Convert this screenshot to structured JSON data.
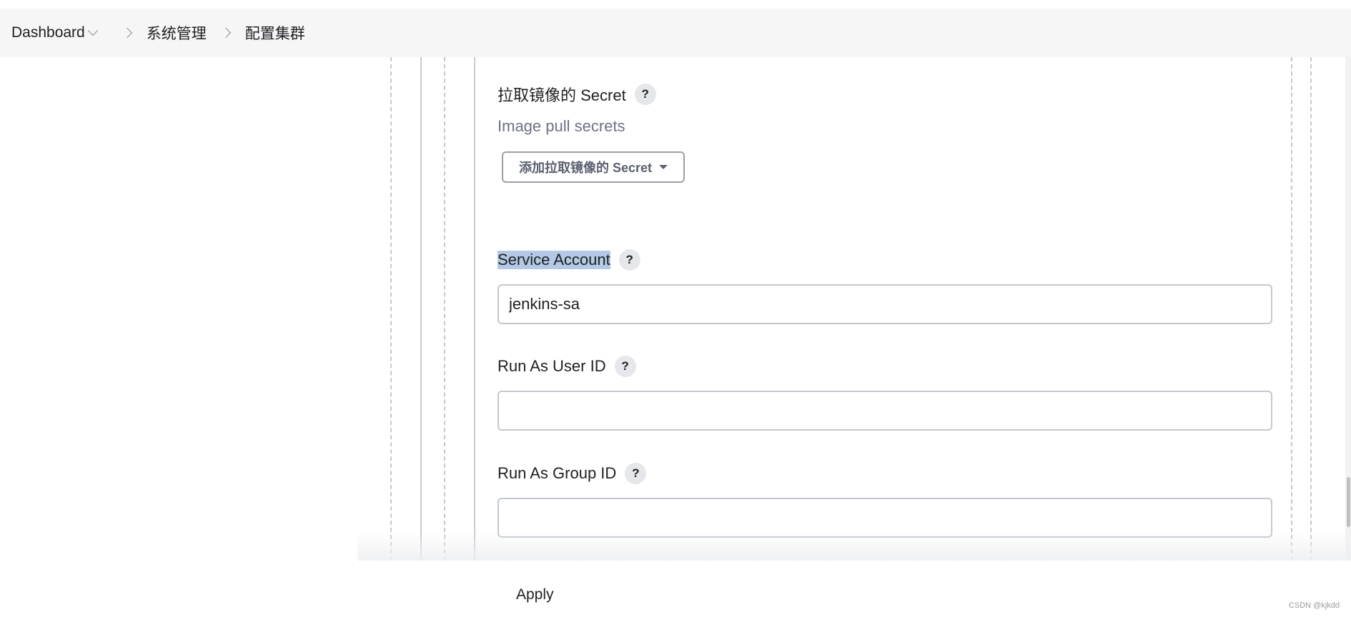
{
  "breadcrumb": {
    "home": "Dashboard",
    "items": [
      "系统管理",
      "配置集群"
    ]
  },
  "form": {
    "image_pull_secret": {
      "label": "拉取镜像的 Secret",
      "description": "Image pull secrets",
      "add_button": "添加拉取镜像的 Secret"
    },
    "service_account": {
      "label": "Service Account",
      "value": "jenkins-sa"
    },
    "run_as_user_id": {
      "label": "Run As User ID",
      "value": ""
    },
    "run_as_group_id": {
      "label": "Run As Group ID",
      "value": ""
    },
    "help_glyph": "?"
  },
  "footer": {
    "apply_label": "Apply"
  },
  "watermark": "CSDN @kjkdd",
  "colors": {
    "header_bg": "#f6f6f7",
    "selection_highlight": "#b3c9e6",
    "border": "#c3c8cf"
  }
}
